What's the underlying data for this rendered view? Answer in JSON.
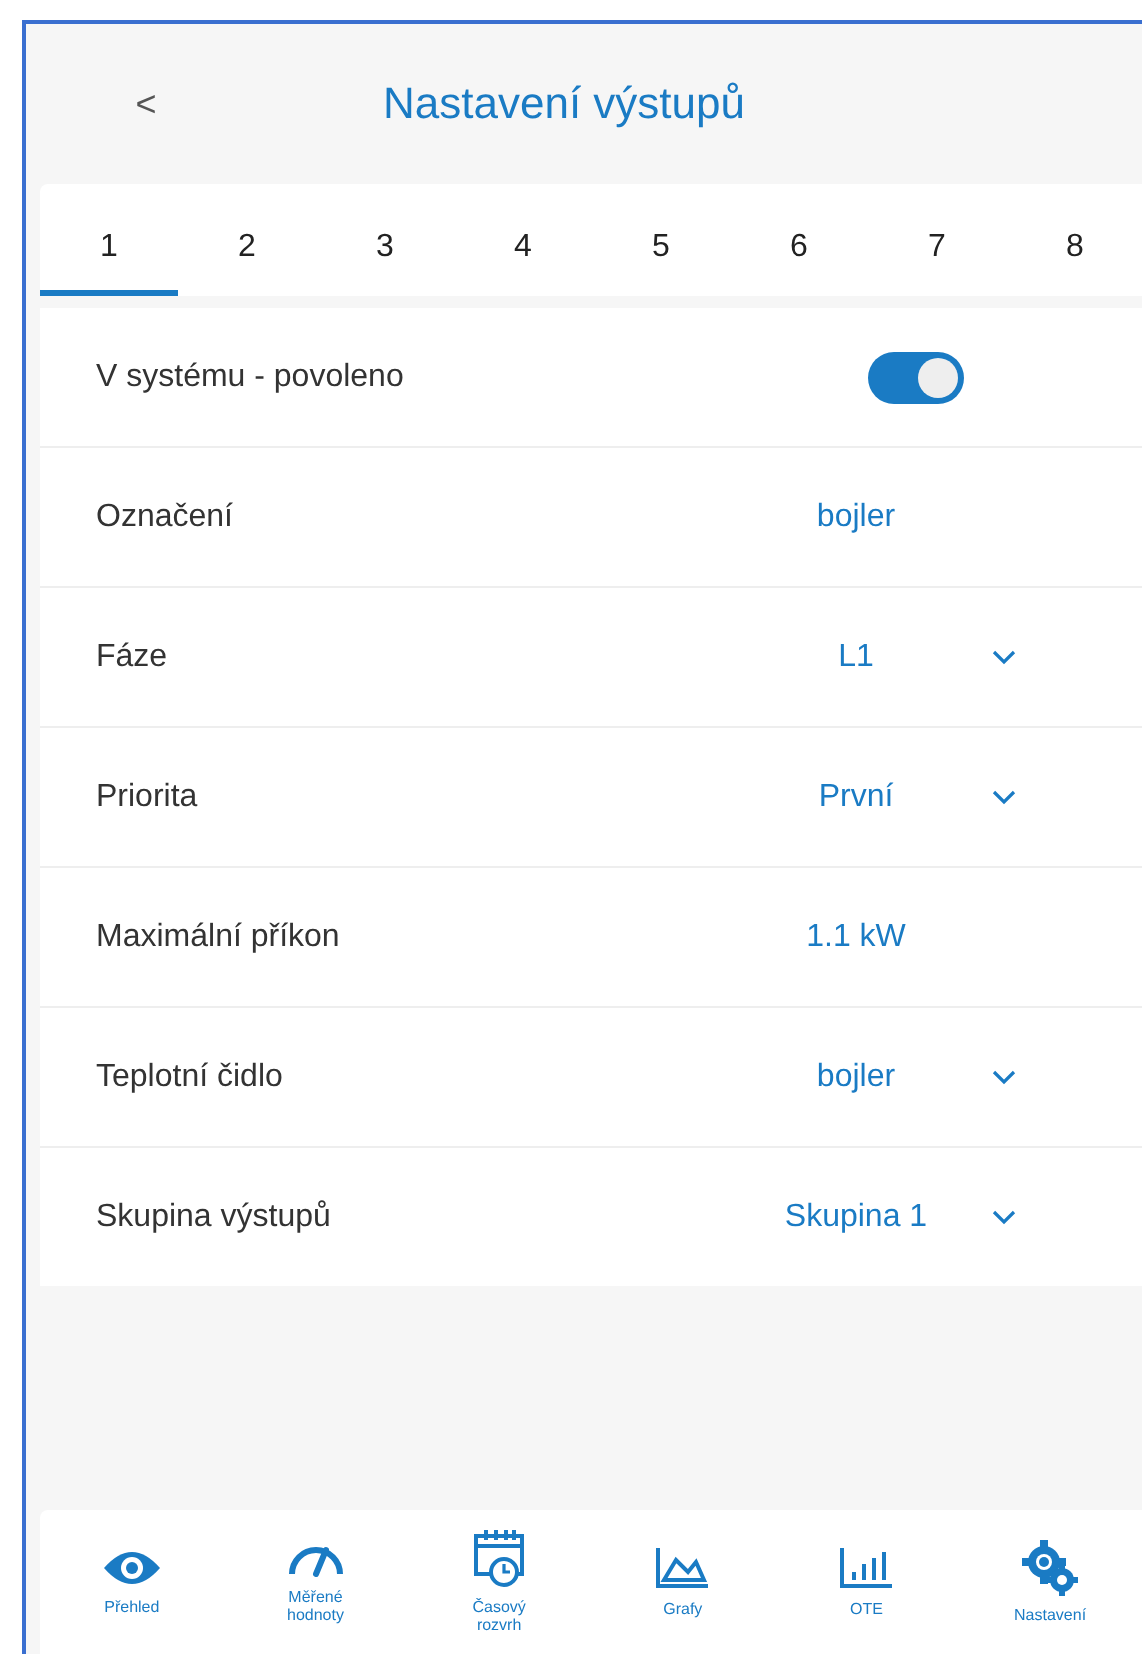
{
  "header": {
    "back": "<",
    "title": "Nastavení výstupů"
  },
  "tabs": [
    {
      "label": "1",
      "selected": true
    },
    {
      "label": "2",
      "selected": false
    },
    {
      "label": "3",
      "selected": false
    },
    {
      "label": "4",
      "selected": false
    },
    {
      "label": "5",
      "selected": false
    },
    {
      "label": "6",
      "selected": false
    },
    {
      "label": "7",
      "selected": false
    },
    {
      "label": "8",
      "selected": false
    }
  ],
  "settings": [
    {
      "kind": "toggle",
      "label": "V systému - povoleno",
      "on": true
    },
    {
      "kind": "text",
      "label": "Označení",
      "value": "bojler"
    },
    {
      "kind": "select",
      "label": "Fáze",
      "value": "L1"
    },
    {
      "kind": "select",
      "label": "Priorita",
      "value": "První"
    },
    {
      "kind": "text",
      "label": "Maximální příkon",
      "value": "1.1 kW"
    },
    {
      "kind": "select",
      "label": "Teplotní čidlo",
      "value": "bojler"
    },
    {
      "kind": "select",
      "label": "Skupina výstupů",
      "value": "Skupina 1"
    }
  ],
  "nav": [
    {
      "label": "Přehled"
    },
    {
      "label": "Měřené hodnoty"
    },
    {
      "label": "Časový rozvrh"
    },
    {
      "label": "Grafy"
    },
    {
      "label": "OTE"
    },
    {
      "label": "Nastavení"
    }
  ]
}
